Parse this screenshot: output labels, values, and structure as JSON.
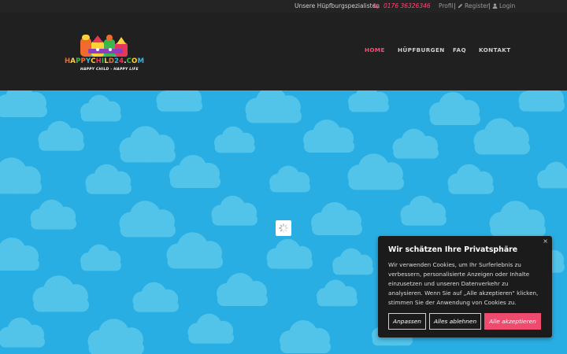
{
  "colors": {
    "accent": "#ff4a78",
    "sky": "#29aee3",
    "cloud": "#52c4ea",
    "header_bg": "#202020",
    "topbar_bg": "#242424",
    "accept_button": "#ee4b6f"
  },
  "topbar": {
    "tagline": "Unsere Hüpfburgspezialisten",
    "phone_icon": "phone-icon",
    "phone": "0176 36326346",
    "profile": "Profil",
    "separator": "|",
    "register_icon": "pencil-icon",
    "register": "Register",
    "login_icon": "user-icon",
    "login": "Login"
  },
  "logo": {
    "letters": [
      "H",
      "A",
      "P",
      "P",
      "Y",
      "C",
      "H",
      "I",
      "L",
      "D",
      "2",
      "4",
      ".",
      "C",
      "O",
      "M"
    ],
    "letter_colors": [
      "#f26a2e",
      "#ffd23a",
      "#3cb64a",
      "#f26a2e",
      "#2fb8e6",
      "#ffd23a",
      "#e8365a",
      "#3cb64a",
      "#ffd23a",
      "#f26a2e",
      "#2fb8e6",
      "#e8365a",
      "#ffffff",
      "#3cb64a",
      "#ffd23a",
      "#2fb8e6"
    ],
    "tagline": "HAPPY CHILD - HAPPY LIFE"
  },
  "nav": {
    "items": [
      {
        "label": "HOME",
        "active": true
      },
      {
        "label": "HÜPFBURGEN",
        "active": false
      },
      {
        "label": "FAQ",
        "active": false
      },
      {
        "label": "KONTAKT",
        "active": false
      }
    ]
  },
  "hero": {
    "loader_icon": "spinner-icon"
  },
  "cookie": {
    "close": "×",
    "title": "Wir schätzen Ihre Privatsphäre",
    "text": "Wir verwenden Cookies, um Ihr Surferlebnis zu verbessern, personalisierte Anzeigen oder Inhalte einzusetzen und unseren Datenverkehr zu analysieren. Wenn Sie auf „Alle akzeptieren\" klicken, stimmen Sie der Anwendung von Cookies zu.",
    "customize": "Anpassen",
    "reject": "Alles ablehnen",
    "accept": "Alle akzeptieren"
  }
}
